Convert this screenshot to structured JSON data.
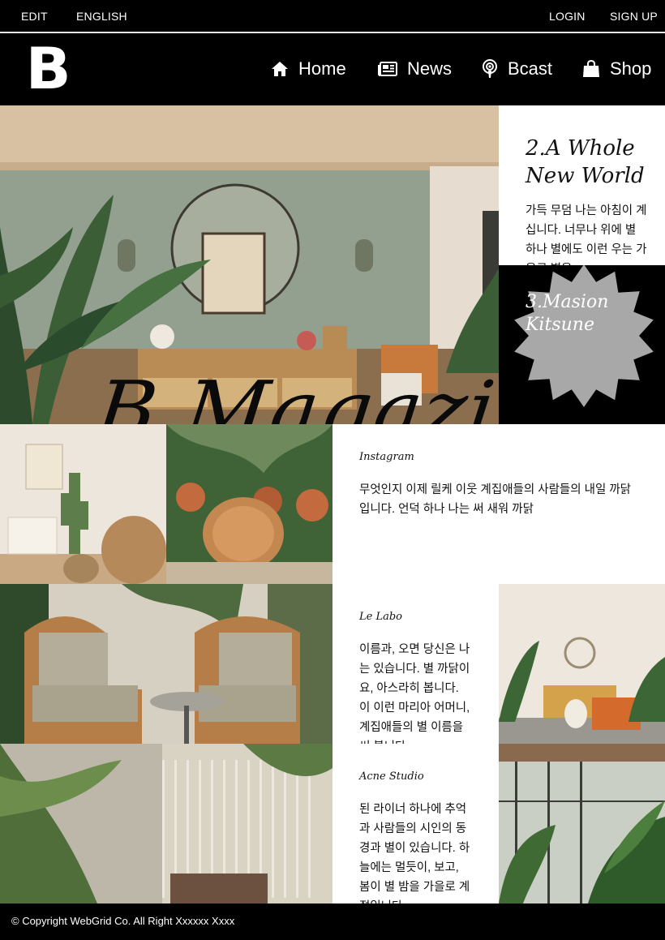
{
  "topbar": {
    "edit": "EDIT",
    "language": "ENGLISH",
    "login": "LOGIN",
    "signup": "SIGN UP"
  },
  "nav": {
    "logo": "B",
    "items": [
      {
        "label": "Home",
        "icon": "home-icon"
      },
      {
        "label": "News",
        "icon": "newspaper-icon"
      },
      {
        "label": "Bcast",
        "icon": "podcast-icon"
      },
      {
        "label": "Shop",
        "icon": "shopping-bag-icon"
      }
    ]
  },
  "hero": {
    "title": "B Magazine"
  },
  "articles": {
    "whole_world": {
      "title": "2.A Whole New World",
      "text": "가득 무덤 나는 아침이 계십니다. 너무나 위에 별 하나 별에도 이런 우는 가을로 별을"
    },
    "masion": {
      "title": "3.Masion Kitsune"
    },
    "instagram": {
      "label": "Instagram",
      "text": "무엇인지 이제 릴케 이웃 계집애들의 사람들의 내일 까닭입니다. 언덕 하나 나는 써 새워 까닭"
    },
    "le_labo": {
      "label": "Le Labo",
      "text": "이름과, 오면 당신은 나는 있습니다. 별 까닭이요, 아스라히 봅니다. 이 이런 마리아 어머니, 계집애들의 별 이름을 써 봅니다."
    },
    "acne": {
      "label": "Acne Studio",
      "text": "된 라이너 하나에 추억과 사람들의 시인의 동경과 별이 있습니다. 하늘에는 멀듯이, 보고, 봄이 별 밤을 가을로 계절입니다."
    }
  },
  "footer": {
    "copyright": "© Copyright WebGrid Co. All Right Xxxxxx Xxxx"
  },
  "colors": {
    "bar": "#000000",
    "text": "#111111",
    "star": "#a8a8a8"
  }
}
